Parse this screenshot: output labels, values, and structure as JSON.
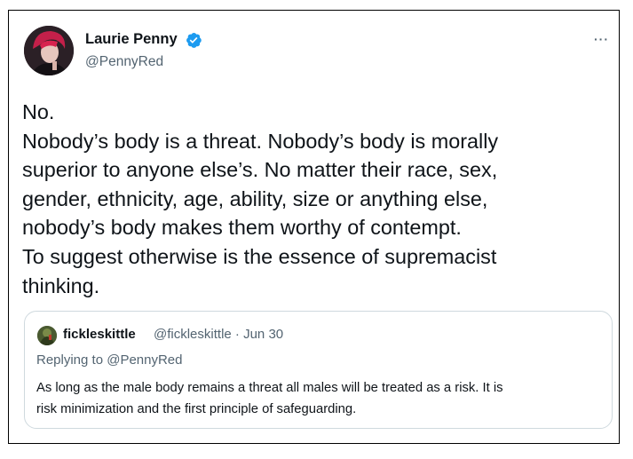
{
  "author": {
    "name": "Laurie Penny",
    "handle": "@PennyRed",
    "verified_icon": "verified-badge-icon"
  },
  "more_label": "···",
  "tweet": {
    "lines": [
      "No.",
      "Nobody’s body is a threat. Nobody’s body is morally",
      "superior to anyone else’s. No matter their race, sex,",
      "gender, ethnicity, age, ability, size or anything else,",
      "nobody’s body makes them worthy of contempt.",
      "To suggest otherwise is the essence of supremacist",
      "thinking."
    ]
  },
  "quoted": {
    "name": "fickleskittle",
    "handle": "@fickleskittle",
    "separator": "·",
    "date": "Jun 30",
    "replying_prefix": "Replying to",
    "replying_to": "@PennyRed",
    "lines": [
      "As long as the male body remains a threat all males will be treated as a risk. It is",
      "risk minimization and the first principle of safeguarding."
    ]
  },
  "colors": {
    "text": "#0f1419",
    "secondary": "#536471",
    "verified": "#1d9bf0",
    "border": "#cfd9de"
  }
}
